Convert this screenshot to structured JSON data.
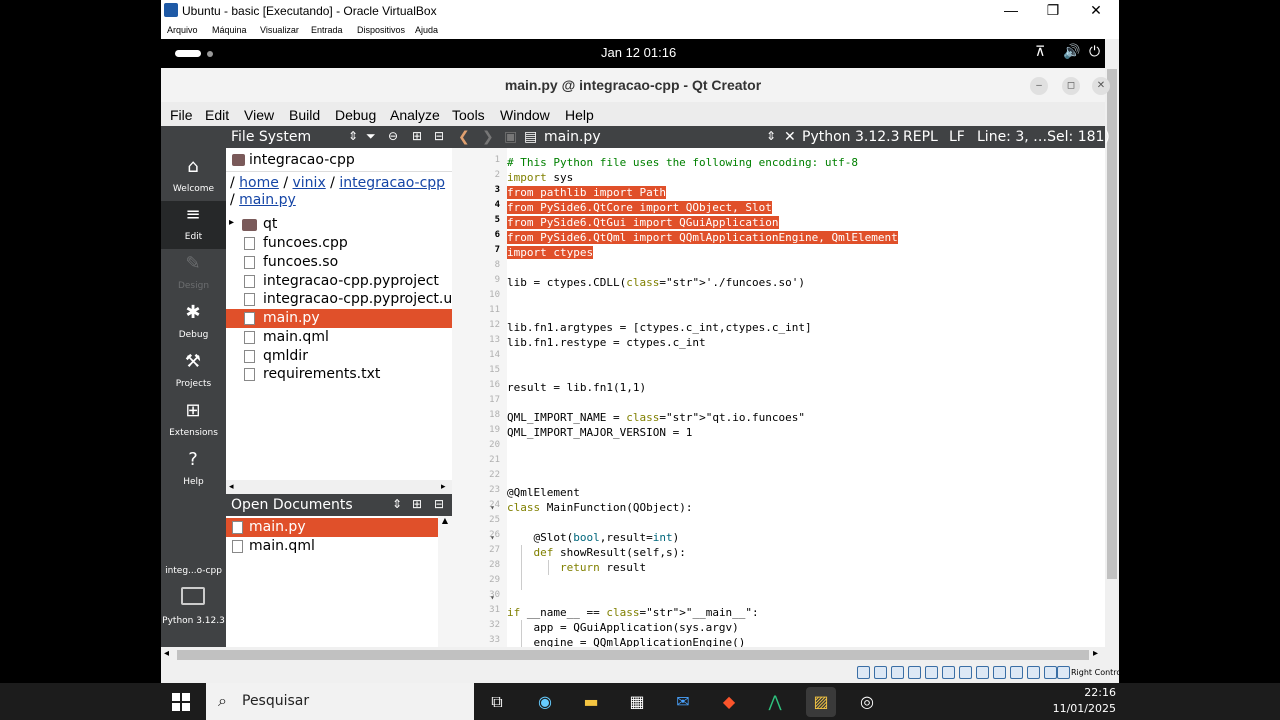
{
  "vbox": {
    "window_title": "Ubuntu - basic [Executando] - Oracle VirtualBox",
    "menu": [
      "Arquivo",
      "Máquina",
      "Visualizar",
      "Entrada",
      "Dispositivos",
      "Ajuda"
    ],
    "status_right": "Right Control"
  },
  "gnome": {
    "clock": "Jan 12  01:16"
  },
  "qt": {
    "title": "main.py @ integracao-cpp - Qt Creator",
    "menu": [
      "File",
      "Edit",
      "View",
      "Build",
      "Debug",
      "Analyze",
      "Tools",
      "Window",
      "Help"
    ],
    "modes": [
      {
        "label": "Welcome",
        "icon": "home-icon",
        "glyph": "⌂"
      },
      {
        "label": "Edit",
        "icon": "edit-icon",
        "glyph": "≡"
      },
      {
        "label": "Design",
        "icon": "design-icon",
        "glyph": "✎"
      },
      {
        "label": "Debug",
        "icon": "debug-icon",
        "glyph": "✱"
      },
      {
        "label": "Projects",
        "icon": "projects-icon",
        "glyph": "⚒"
      },
      {
        "label": "Extensions",
        "icon": "extensions-icon",
        "glyph": "⊞"
      },
      {
        "label": "Help",
        "icon": "help-icon",
        "glyph": "?"
      }
    ],
    "kit_label": "integ...o-cpp",
    "kit_python": "Python 3.12.3",
    "file_system": {
      "header": "File System",
      "root": "integracao-cpp",
      "breadcrumb": [
        "home",
        "vinix",
        "integracao-cpp",
        "main.py"
      ],
      "items": [
        {
          "name": "qt",
          "type": "folder"
        },
        {
          "name": "funcoes.cpp",
          "type": "file"
        },
        {
          "name": "funcoes.so",
          "type": "file"
        },
        {
          "name": "integracao-cpp.pyproject",
          "type": "file"
        },
        {
          "name": "integracao-cpp.pyproject.user",
          "type": "file"
        },
        {
          "name": "main.py",
          "type": "file",
          "selected": true
        },
        {
          "name": "main.qml",
          "type": "file"
        },
        {
          "name": "qmldir",
          "type": "file"
        },
        {
          "name": "requirements.txt",
          "type": "file"
        }
      ]
    },
    "open_documents": {
      "header": "Open Documents",
      "items": [
        "main.py",
        "main.qml"
      ]
    },
    "editor": {
      "file": "main.py",
      "python": "Python 3.12.3",
      "repl": "REPL",
      "eol": "LF",
      "position": "Line: 3, …Sel: 181)",
      "lines": [
        {
          "n": "1",
          "text": "# This Python file uses the following encoding: utf-8",
          "kind": "comment"
        },
        {
          "n": "2",
          "text": "import sys",
          "kind": "import"
        },
        {
          "n": "3",
          "text": "from pathlib import Path",
          "kind": "sel"
        },
        {
          "n": "4",
          "text": "from PySide6.QtCore import QObject, Slot",
          "kind": "sel"
        },
        {
          "n": "5",
          "text": "from PySide6.QtGui import QGuiApplication",
          "kind": "sel"
        },
        {
          "n": "6",
          "text": "from PySide6.QtQml import QQmlApplicationEngine, QmlElement",
          "kind": "sel"
        },
        {
          "n": "7",
          "text": "import ctypes",
          "kind": "sel"
        },
        {
          "n": "8",
          "text": "",
          "kind": "plain"
        },
        {
          "n": "9",
          "text": "lib = ctypes.CDLL('./funcoes.so')",
          "kind": "plain"
        },
        {
          "n": "10",
          "text": "",
          "kind": "plain"
        },
        {
          "n": "11",
          "text": "",
          "kind": "plain"
        },
        {
          "n": "12",
          "text": "lib.fn1.argtypes = [ctypes.c_int,ctypes.c_int]",
          "kind": "plain"
        },
        {
          "n": "13",
          "text": "lib.fn1.restype = ctypes.c_int",
          "kind": "plain"
        },
        {
          "n": "14",
          "text": "",
          "kind": "plain"
        },
        {
          "n": "15",
          "text": "",
          "kind": "plain"
        },
        {
          "n": "16",
          "text": "result = lib.fn1(1,1)",
          "kind": "plain"
        },
        {
          "n": "17",
          "text": "",
          "kind": "plain"
        },
        {
          "n": "18",
          "text": "QML_IMPORT_NAME = \"qt.io.funcoes\"",
          "kind": "plain"
        },
        {
          "n": "19",
          "text": "QML_IMPORT_MAJOR_VERSION = 1",
          "kind": "plain"
        },
        {
          "n": "20",
          "text": "",
          "kind": "plain"
        },
        {
          "n": "21",
          "text": "",
          "kind": "plain"
        },
        {
          "n": "22",
          "text": "",
          "kind": "plain"
        },
        {
          "n": "23",
          "text": "@QmlElement",
          "kind": "plain"
        },
        {
          "n": "24",
          "text": "class MainFunction(QObject):",
          "kind": "plain"
        },
        {
          "n": "25",
          "text": "",
          "kind": "plain"
        },
        {
          "n": "26",
          "text": "    @Slot(bool,result=int)",
          "kind": "plain"
        },
        {
          "n": "27",
          "text": "    def showResult(self,s):",
          "kind": "plain"
        },
        {
          "n": "28",
          "text": "        return result",
          "kind": "plain"
        },
        {
          "n": "29",
          "text": "",
          "kind": "plain"
        },
        {
          "n": "30",
          "text": "",
          "kind": "plain"
        },
        {
          "n": "31",
          "text": "if __name__ == \"__main__\":",
          "kind": "plain"
        },
        {
          "n": "32",
          "text": "    app = QGuiApplication(sys.argv)",
          "kind": "plain"
        },
        {
          "n": "33",
          "text": "    engine = QQmlApplicationEngine()",
          "kind": "plain"
        }
      ]
    }
  },
  "taskbar": {
    "search_placeholder": "Pesquisar",
    "time": "22:16",
    "date": "11/01/2025"
  }
}
